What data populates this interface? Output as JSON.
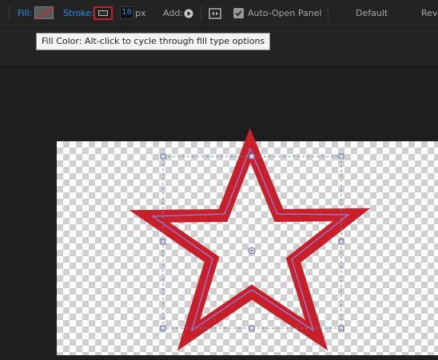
{
  "toolbar": {
    "fill_label": "Fill:",
    "stroke_label": "Stroke:",
    "stroke_width": "18",
    "stroke_unit": "px",
    "add_label": "Add:",
    "auto_open_label": "Auto-Open Panel",
    "auto_open_checked": true,
    "workspace_default": "Default",
    "workspace_review": "Revi"
  },
  "tooltip": {
    "text": "Fill Color: Alt-click to cycle through fill type options"
  },
  "colors": {
    "accent_blue": "#2d8ceb",
    "stroke_red": "#c8202a",
    "path_purple": "#8f86ea"
  },
  "icons": {
    "fill_swatch": "no-fill-swatch-icon",
    "stroke_swatch": "stroke-color-swatch-icon",
    "add_menu": "play-circle-icon",
    "snapping": "snapping-icon",
    "checkbox": "checkbox-icon"
  }
}
